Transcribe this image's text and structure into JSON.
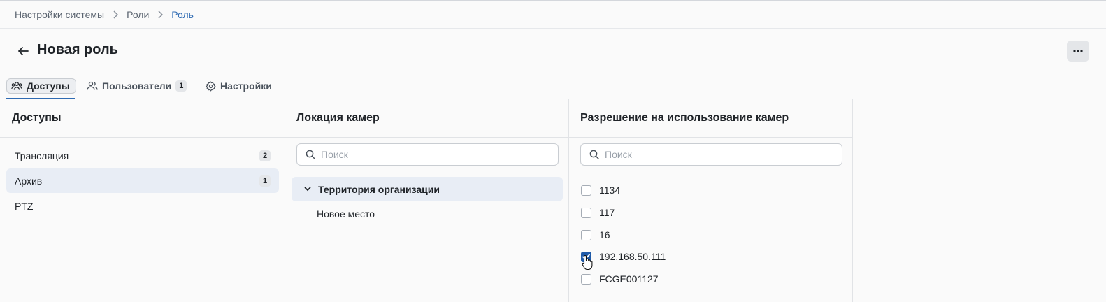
{
  "breadcrumb": {
    "items": [
      "Настройки системы",
      "Роли",
      "Роль"
    ]
  },
  "header": {
    "title": "Новая роль",
    "back_icon": "arrow-left-icon",
    "more_icon": "more-horizontal-icon"
  },
  "tabs": [
    {
      "label": "Доступы",
      "icon": "users-group-icon",
      "active": true
    },
    {
      "label": "Пользователи",
      "icon": "users-icon",
      "badge": "1"
    },
    {
      "label": "Настройки",
      "icon": "gear-icon"
    }
  ],
  "access": {
    "title": "Доступы",
    "items": [
      {
        "label": "Трансляция",
        "count": "2"
      },
      {
        "label": "Архив",
        "count": "1",
        "selected": true
      },
      {
        "label": "PTZ",
        "count": ""
      }
    ]
  },
  "location": {
    "title": "Локация камер",
    "search_placeholder": "Поиск",
    "tree": [
      {
        "label": "Территория организации",
        "expanded": true,
        "selected": true
      },
      {
        "label": "Новое место"
      }
    ]
  },
  "permissions": {
    "title": "Разрешение на использование камер",
    "search_placeholder": "Поиск",
    "cameras": [
      {
        "label": "1134",
        "checked": false
      },
      {
        "label": "117",
        "checked": false
      },
      {
        "label": "16",
        "checked": false
      },
      {
        "label": "192.168.50.111",
        "checked": true
      },
      {
        "label": "FCGE001127",
        "checked": false
      }
    ]
  },
  "colors": {
    "accent": "#2f6bb3",
    "checkbox_checked": "#1f5aa8",
    "selected_row": "#e8edf5"
  }
}
